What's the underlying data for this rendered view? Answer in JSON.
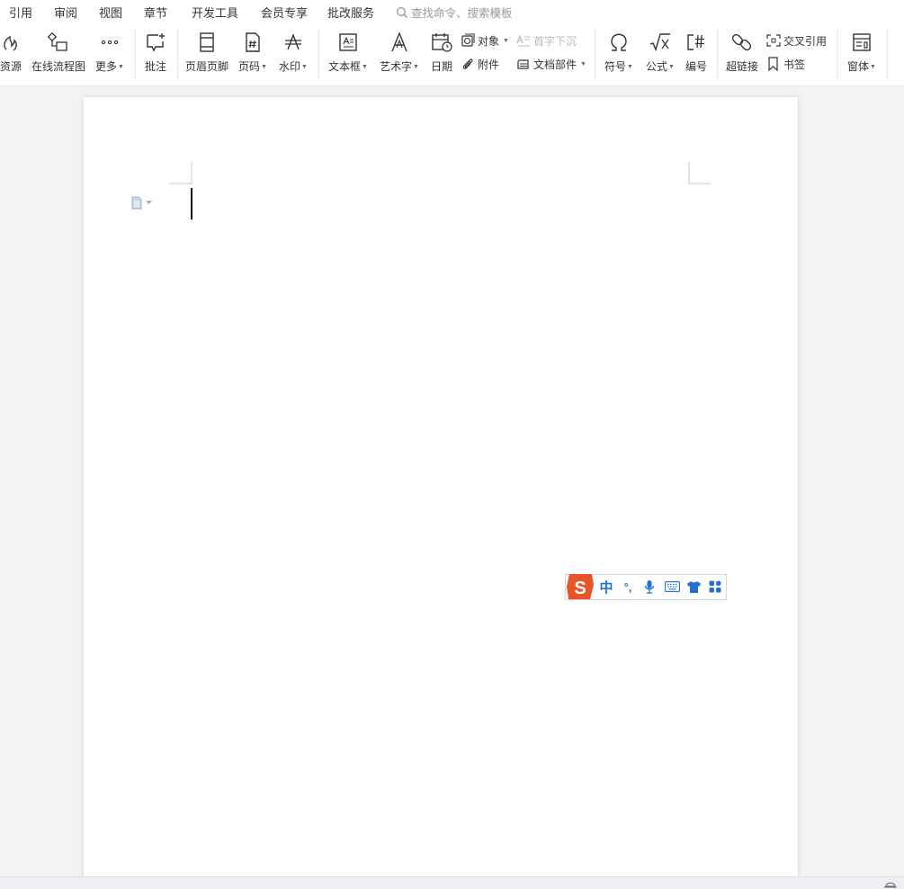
{
  "menu": {
    "tabs": [
      "引用",
      "审阅",
      "视图",
      "章节",
      "开发工具",
      "会员专享",
      "批改服务"
    ],
    "search_placeholder": "查找命令、搜索模板"
  },
  "ribbon": {
    "resources": "资源",
    "online_flowchart": "在线流程图",
    "more": "更多",
    "comment": "批注",
    "header_footer": "页眉页脚",
    "page_number": "页码",
    "watermark": "水印",
    "textbox": "文本框",
    "wordart": "艺术字",
    "date": "日期",
    "object": "对象",
    "attachment": "附件",
    "drop_cap": "首字下沉",
    "doc_parts": "文档部件",
    "symbol": "符号",
    "formula": "公式",
    "numbering": "编号",
    "hyperlink": "超链接",
    "cross_reference": "交叉引用",
    "bookmark": "书签",
    "window": "窗体"
  },
  "ime": {
    "logo_letter": "S",
    "mode": "中",
    "punct": "°,"
  },
  "colors": {
    "accent": "#1f6fd6",
    "ime_logo": "#e8542a",
    "page_bg": "#f2f3f5"
  }
}
